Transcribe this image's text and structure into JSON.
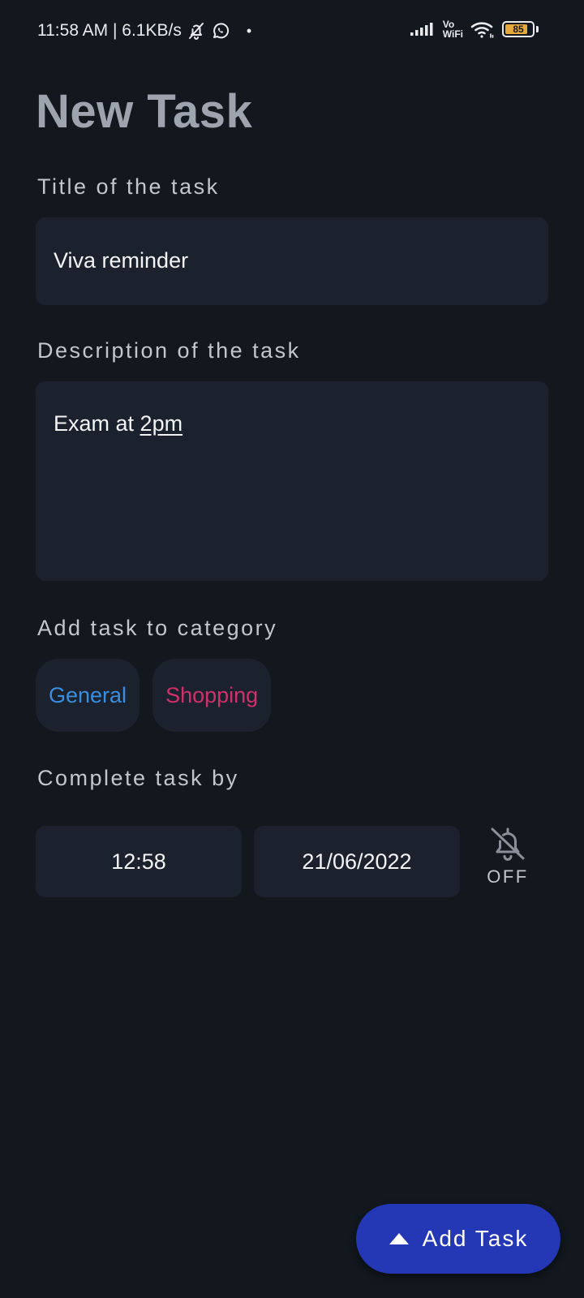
{
  "status_bar": {
    "time_speed": "11:58 AM | 6.1KB/s",
    "dot": "•",
    "vo": "Vo",
    "wifi": "WiFi",
    "battery": "85",
    "battery_level_percent": 85,
    "icons": [
      "bell-off-icon",
      "whatsapp-icon",
      "signal-icon",
      "wifi-icon",
      "battery-icon"
    ]
  },
  "page": {
    "title": "New Task"
  },
  "form": {
    "title_label": "Title of the task",
    "title_value": "Viva reminder",
    "description_label": "Description of the task",
    "description_prefix": "Exam at ",
    "description_link": "2pm",
    "category_label": "Add task to category",
    "categories": [
      {
        "label": "General",
        "color": "#3a8ee0"
      },
      {
        "label": "Shopping",
        "color": "#d0306c"
      }
    ],
    "deadline_label": "Complete task by",
    "time": "12:58",
    "date": "21/06/2022",
    "alarm_status": "OFF",
    "alarm_icon": "alarm-off-icon"
  },
  "fab": {
    "label": "Add Task",
    "icon": "arrow-up-triangle-icon",
    "color": "#2437b5"
  }
}
